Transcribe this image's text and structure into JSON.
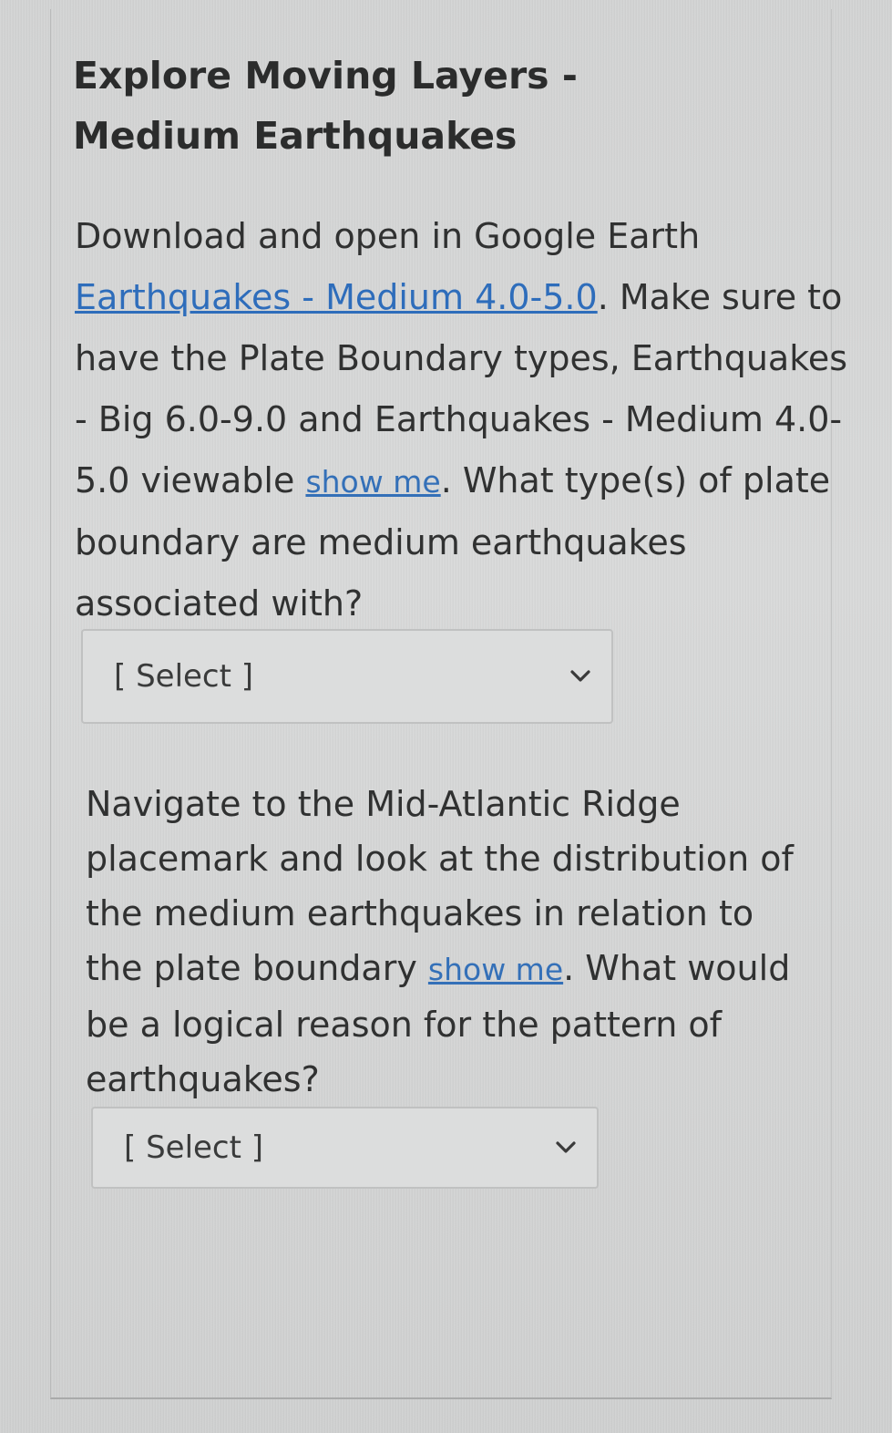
{
  "quiz": {
    "title": "Explore Moving Layers - Medium Earthquakes",
    "questions": [
      {
        "intro": "Download and open in Google Earth ",
        "file_link": "Earthquakes - Medium 4.0-5.0",
        "middle": ". Make sure to have the Plate Boundary types, Earthquakes - Big 6.0-9.0 and Earthquakes - Medium 4.0-5.0 viewable ",
        "show_me": "show me",
        "question": ".  What type(s) of plate boundary are medium earthquakes associated with?",
        "select_value": "[ Select ]"
      },
      {
        "intro": "Navigate to the Mid-Atlantic Ridge placemark and look at the distribution of the medium earthquakes in relation to the plate boundary ",
        "show_me": "show me",
        "question": ".  What would be a logical reason for the pattern of earthquakes?",
        "select_value": "[ Select ]"
      }
    ],
    "icons": {
      "dropdown": "chevron-down-icon"
    },
    "colors": {
      "link": "#2e6dbb",
      "text": "#303131",
      "background": "#d6d7d7"
    }
  }
}
